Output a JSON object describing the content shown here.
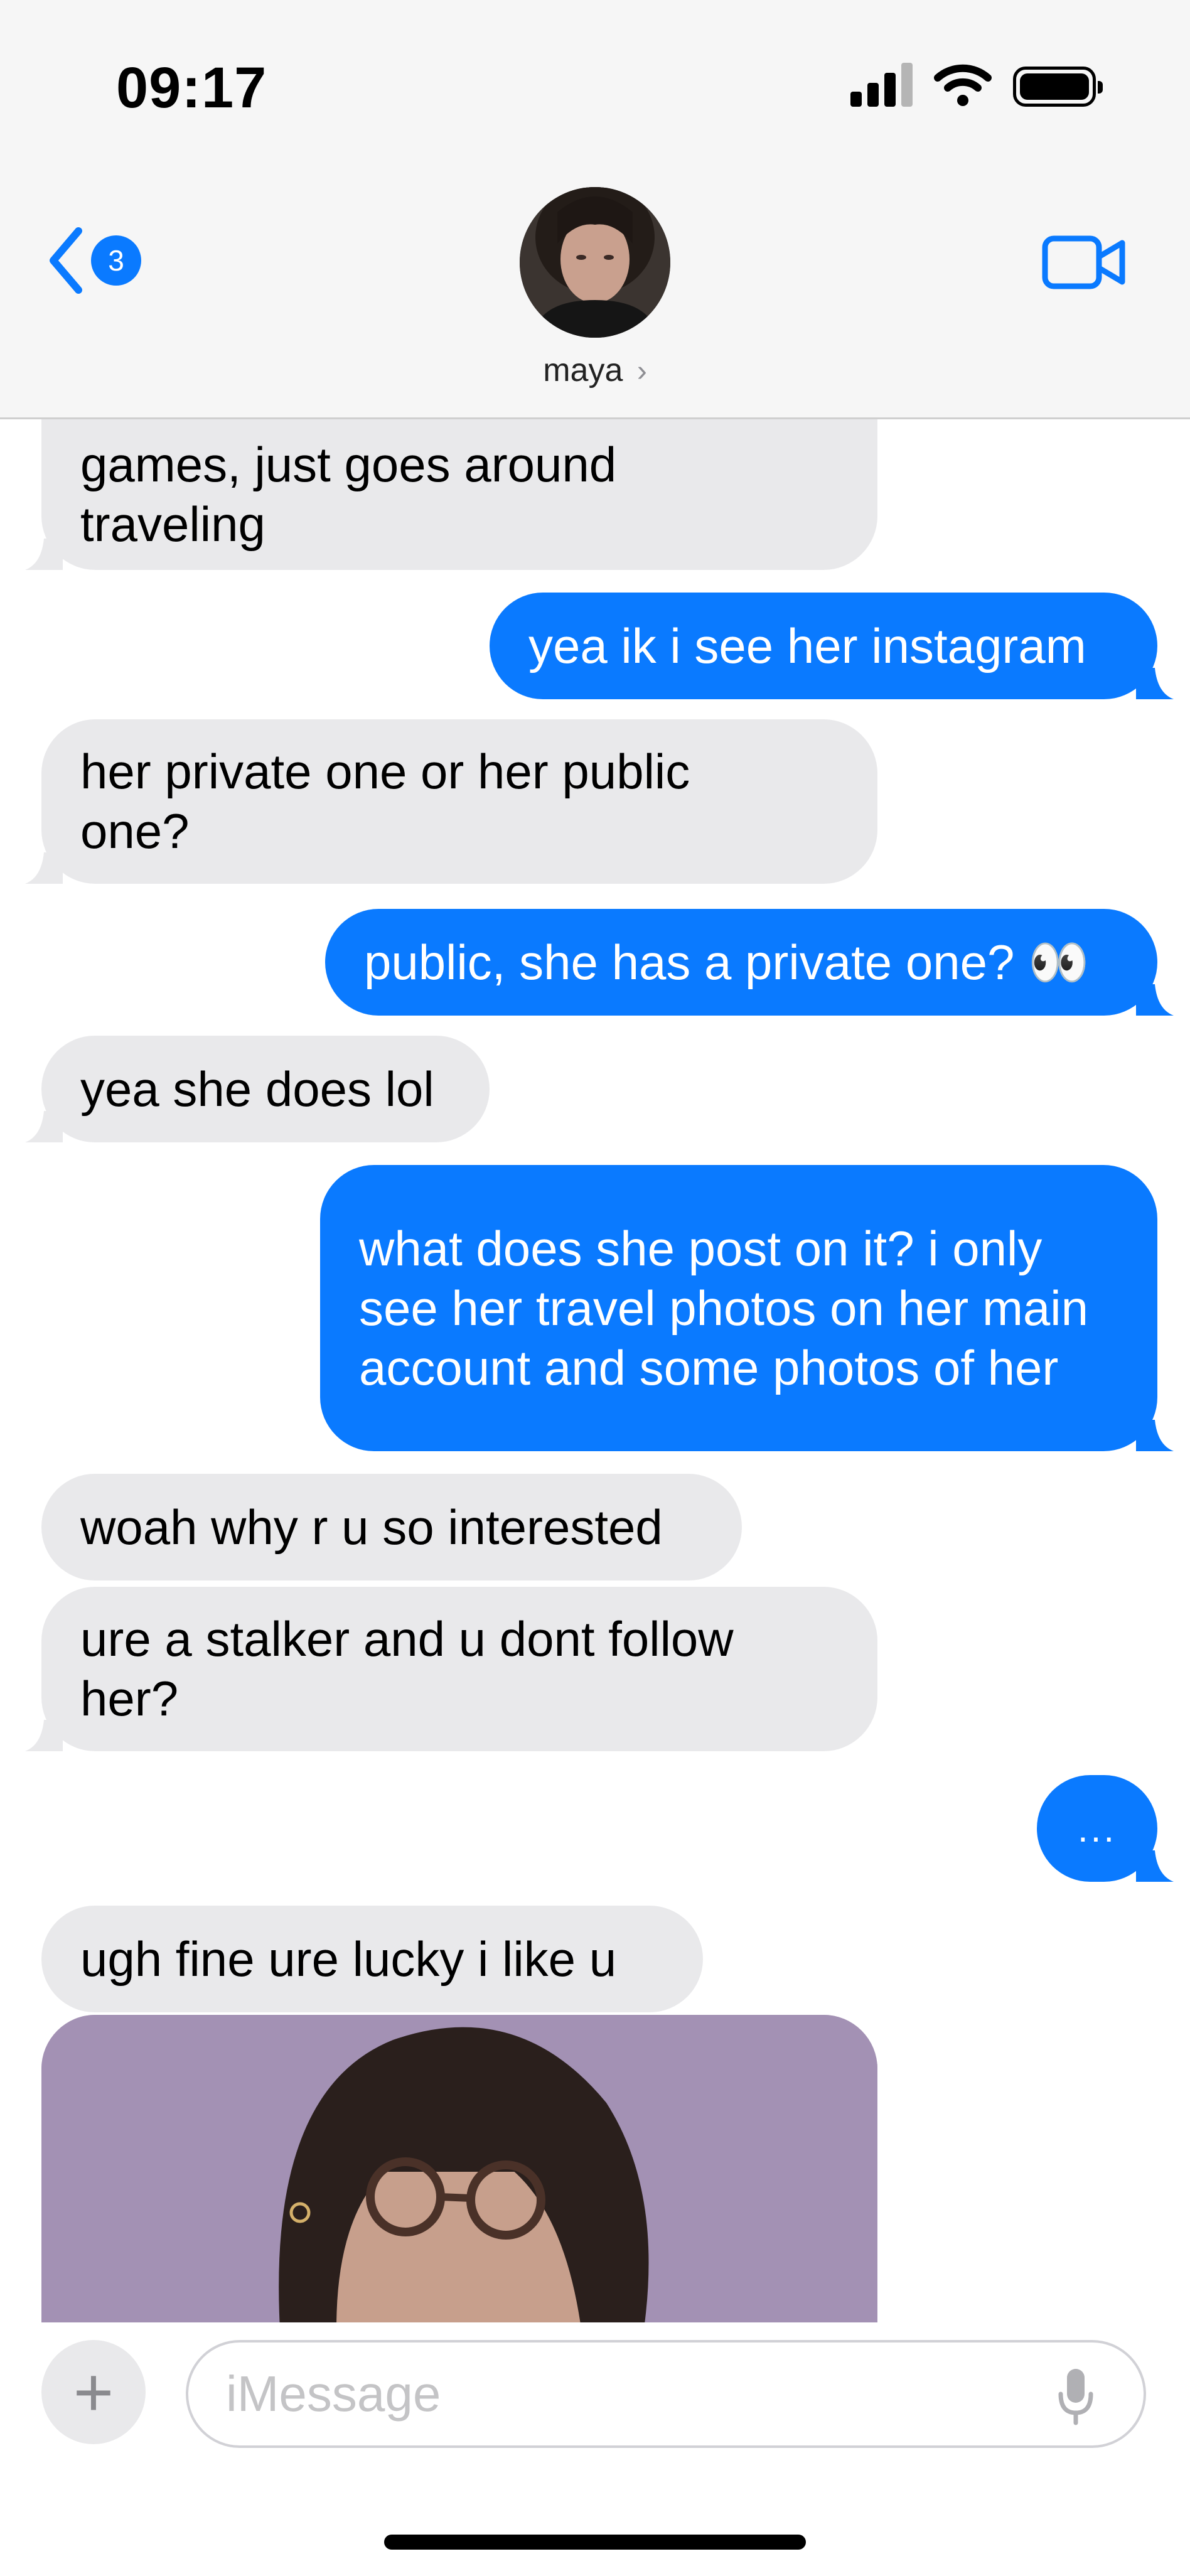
{
  "status_bar": {
    "time": "09:17"
  },
  "nav": {
    "back_count": "3",
    "contact_name": "maya",
    "chevron": "›"
  },
  "messages": [
    {
      "side": "in",
      "text": "games, just goes around traveling"
    },
    {
      "side": "out",
      "text": "yea ik i see her instagram"
    },
    {
      "side": "in",
      "text": "her private one or her public one?"
    },
    {
      "side": "out",
      "text": "public, she has a private one? 👀"
    },
    {
      "side": "in",
      "text": "yea she does lol"
    },
    {
      "side": "out",
      "text": "what does she post on it? i only see her travel photos on her main account and some photos of her"
    },
    {
      "side": "in",
      "text": "woah why r u so interested"
    },
    {
      "side": "in",
      "text": "ure a stalker and u dont follow her?"
    },
    {
      "side": "out",
      "text": "..."
    },
    {
      "side": "in",
      "text": "ugh fine ure lucky i like u"
    }
  ],
  "composer": {
    "plus": "+",
    "placeholder": "iMessage"
  },
  "icons": {
    "back": "chevron-left-icon",
    "video": "video-camera-icon",
    "mic": "microphone-icon",
    "signal": "cellular-signal-icon",
    "wifi": "wifi-icon",
    "battery": "battery-icon"
  },
  "colors": {
    "accent": "#0a7aff",
    "incoming_bubble": "#e9e9eb",
    "header_bg": "#f6f6f6"
  }
}
